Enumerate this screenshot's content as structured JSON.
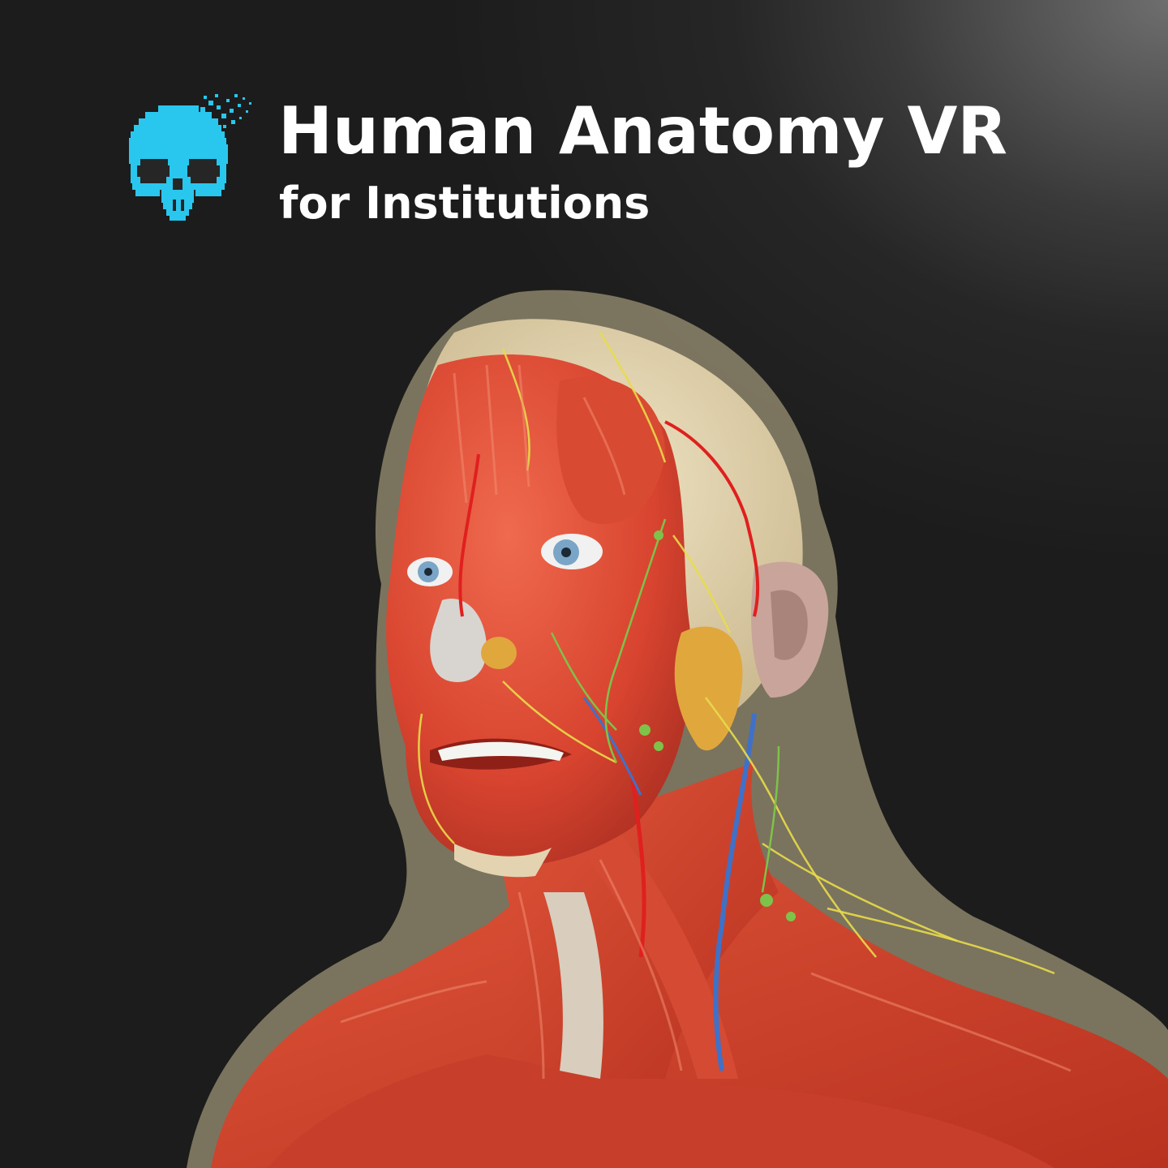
{
  "brand": {
    "title": "Human Anatomy VR",
    "subtitle": "for Institutions",
    "logo_icon": "pixel-skull-icon",
    "logo_color": "#29c6ee"
  },
  "artwork": {
    "subject_icon": "anatomical-head-neck-icon",
    "muscle_color": "#d8442f",
    "skin_color": "#d9c9a4",
    "gland_color": "#e0a73c",
    "nerve_color": "#e8dc4a",
    "artery_color": "#e0201e",
    "vein_color": "#3f71c8",
    "background_color": "#1c1c1c",
    "highlight_color": "#6e6e6e"
  }
}
